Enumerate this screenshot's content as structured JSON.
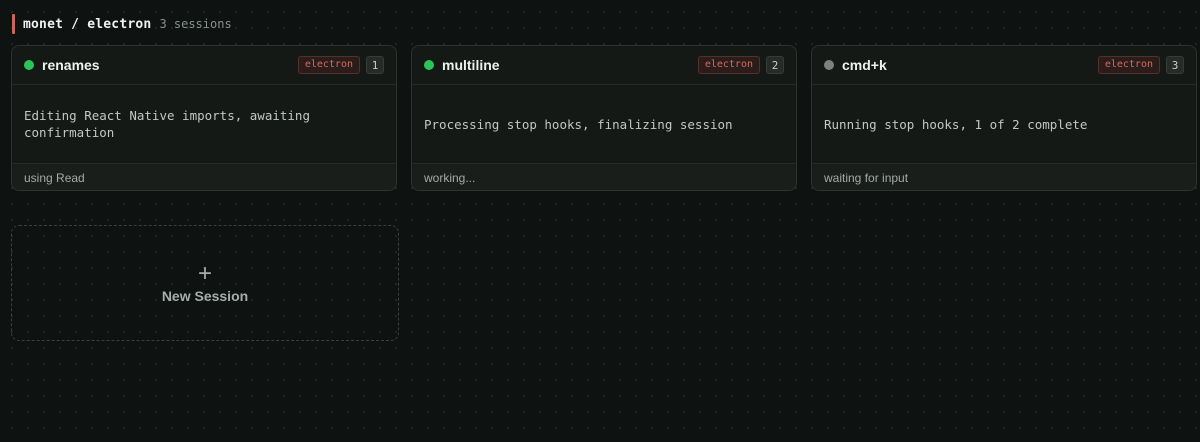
{
  "header": {
    "title": "monet / electron",
    "count": "3 sessions",
    "accent_color": "#c8675a"
  },
  "sessions": [
    {
      "name": "renames",
      "status_color": "#2bc65a",
      "badge": "electron",
      "index": "1",
      "description": "Editing React Native imports, awaiting confirmation",
      "status": "using Read"
    },
    {
      "name": "multiline",
      "status_color": "#2bc65a",
      "badge": "electron",
      "index": "2",
      "description": "Processing stop hooks, finalizing session",
      "status": "working..."
    },
    {
      "name": "cmd+k",
      "status_color": "#7d827f",
      "badge": "electron",
      "index": "3",
      "description": "Running stop hooks, 1 of 2 complete",
      "status": "waiting for input"
    }
  ],
  "new_session": {
    "icon": "plus-icon",
    "label": "New Session"
  }
}
